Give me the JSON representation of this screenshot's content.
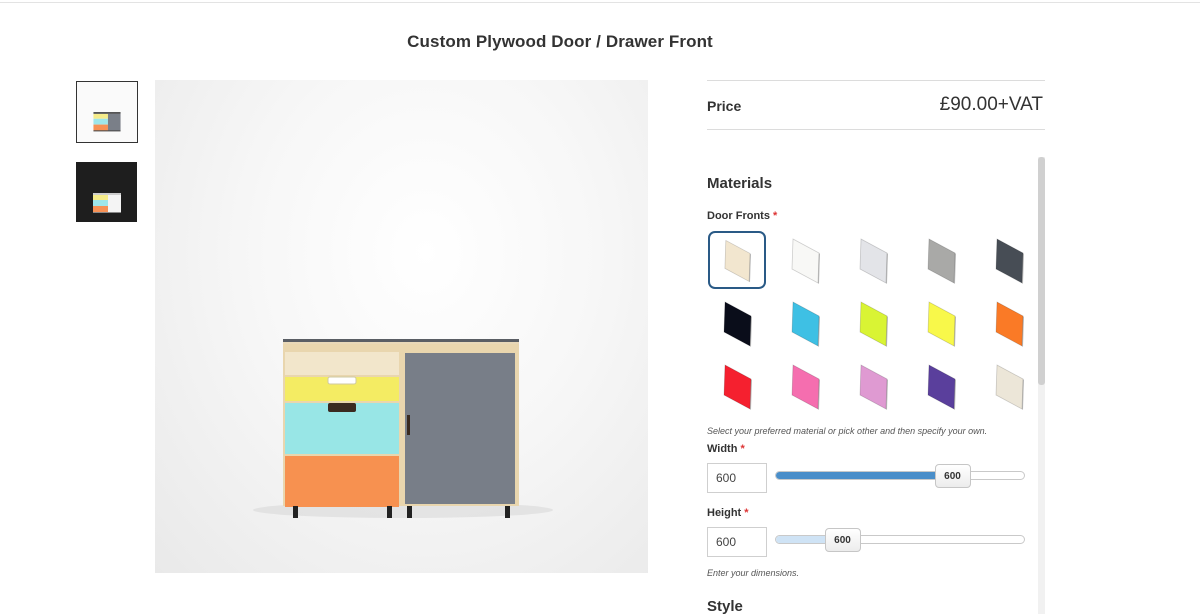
{
  "product": {
    "title": "Custom Plywood Door / Drawer Front"
  },
  "gallery": {
    "thumbnails": [
      {
        "name": "white-background-view",
        "selected": true
      },
      {
        "name": "dark-background-view",
        "selected": false
      }
    ]
  },
  "price": {
    "label": "Price",
    "value": "£90.00+VAT"
  },
  "materials": {
    "heading": "Materials",
    "door_fronts_label": "Door Fronts",
    "required_mark": "*",
    "swatches": [
      {
        "color": "#f2e6cf",
        "selected": true
      },
      {
        "color": "#f8f8f6",
        "selected": false
      },
      {
        "color": "#e3e4e8",
        "selected": false
      },
      {
        "color": "#a9a9a7",
        "selected": false
      },
      {
        "color": "#474d55",
        "selected": false
      },
      {
        "color": "#0a0d1a",
        "selected": false
      },
      {
        "color": "#3ec0e4",
        "selected": false
      },
      {
        "color": "#d9f434",
        "selected": false
      },
      {
        "color": "#f8f84a",
        "selected": false
      },
      {
        "color": "#fa7a26",
        "selected": false
      },
      {
        "color": "#f5202f",
        "selected": false
      },
      {
        "color": "#f56eaf",
        "selected": false
      },
      {
        "color": "#df9ad2",
        "selected": false
      },
      {
        "color": "#5a3f9c",
        "selected": false
      },
      {
        "color": "#ece6d8",
        "selected": false
      }
    ],
    "help_text": "Select your preferred material or pick other and then specify your own."
  },
  "dimensions": {
    "width": {
      "label": "Width",
      "required_mark": "*",
      "value": "600",
      "handle_label": "600",
      "fill_fraction": 0.71
    },
    "height": {
      "label": "Height",
      "required_mark": "*",
      "value": "600",
      "handle_label": "600",
      "fill_fraction": 0.27
    },
    "help_text": "Enter your dimensions."
  },
  "style": {
    "heading": "Style"
  },
  "colors": {
    "accent": "#2a5a86",
    "slider_active": "#4a8ec9",
    "slider_light": "#cfe3f5",
    "required": "#dd3333"
  }
}
